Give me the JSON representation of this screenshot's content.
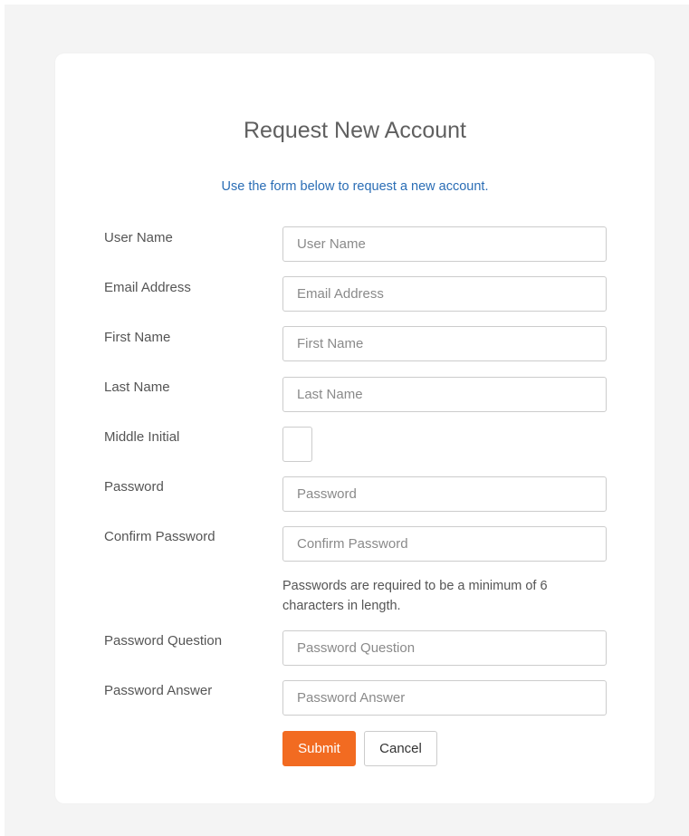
{
  "form": {
    "title": "Request New Account",
    "subtitle": "Use the form below to request a new account.",
    "fields": [
      {
        "label": "User Name",
        "placeholder": "User Name",
        "value": ""
      },
      {
        "label": "Email Address",
        "placeholder": "Email Address",
        "value": ""
      },
      {
        "label": "First Name",
        "placeholder": "First Name",
        "value": ""
      },
      {
        "label": "Last Name",
        "placeholder": "Last Name",
        "value": ""
      },
      {
        "label": "Middle Initial",
        "placeholder": "",
        "value": ""
      },
      {
        "label": "Password",
        "placeholder": "Password",
        "value": ""
      },
      {
        "label": "Confirm Password",
        "placeholder": "Confirm Password",
        "value": ""
      },
      {
        "label": "Password Question",
        "placeholder": "Password Question",
        "value": ""
      },
      {
        "label": "Password Answer",
        "placeholder": "Password Answer",
        "value": ""
      }
    ],
    "password_note": "Passwords are required to be a minimum of 6 characters in length.",
    "submit_label": "Submit",
    "cancel_label": "Cancel",
    "colors": {
      "subtitle": "#2a6db5",
      "submit_button": "#f26b21"
    }
  }
}
